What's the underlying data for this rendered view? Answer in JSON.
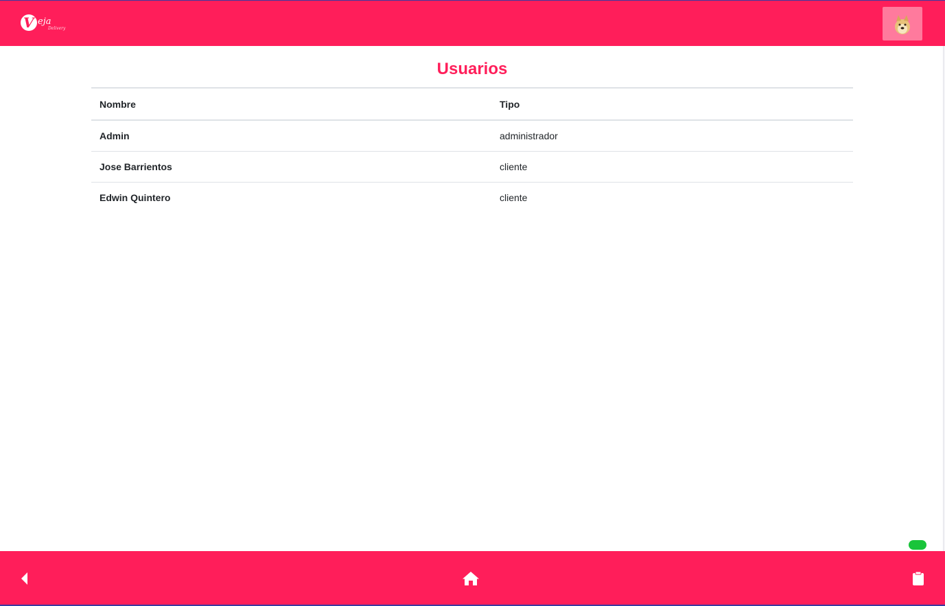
{
  "header": {
    "logo": {
      "mark": "V",
      "word": "eja",
      "sub": "Delivery"
    },
    "avatar_icon": "doge-avatar-icon"
  },
  "main": {
    "title": "Usuarios",
    "table": {
      "columns": [
        "Nombre",
        "Tipo"
      ],
      "rows": [
        {
          "nombre": "Admin",
          "tipo": "administrador"
        },
        {
          "nombre": "Jose Barrientos",
          "tipo": "cliente"
        },
        {
          "nombre": "Edwin Quintero",
          "tipo": "cliente"
        }
      ]
    }
  },
  "status_indicator": {
    "color": "#19c43a"
  },
  "footer": {
    "buttons": [
      {
        "icon": "back-arrow-icon"
      },
      {
        "icon": "home-icon"
      },
      {
        "icon": "clipboard-icon"
      }
    ]
  },
  "colors": {
    "brand": "#ff1e5a",
    "avatar_bg": "#ff7a9d",
    "text": "#212529",
    "divider": "#dee2e6"
  }
}
